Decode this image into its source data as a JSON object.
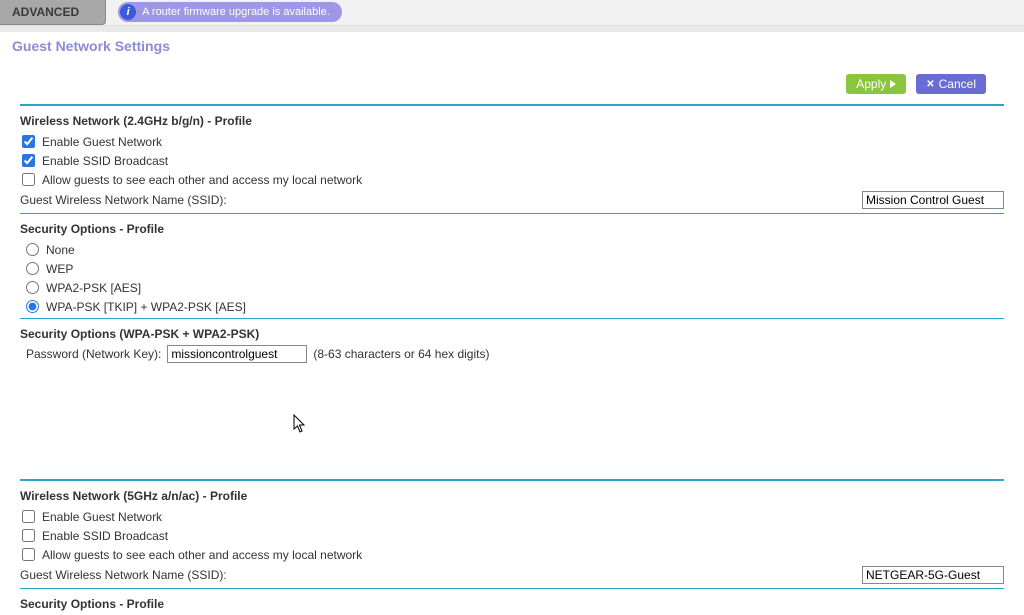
{
  "header": {
    "tab_advanced": "ADVANCED",
    "firmware_notice": "A router firmware upgrade is available."
  },
  "page_title": "Guest Network Settings",
  "buttons": {
    "apply": "Apply",
    "cancel": "Cancel"
  },
  "band24": {
    "title": "Wireless Network (2.4GHz b/g/n) - Profile",
    "enable_guest_label": "Enable Guest Network",
    "enable_guest_checked": true,
    "enable_ssid_label": "Enable SSID Broadcast",
    "enable_ssid_checked": true,
    "allow_guests_label": "Allow guests to see each other and access my local network",
    "allow_guests_checked": false,
    "ssid_label": "Guest Wireless Network Name (SSID):",
    "ssid_value": "Mission Control Guest"
  },
  "security24": {
    "title": "Security Options - Profile",
    "opt_none": "None",
    "opt_wep": "WEP",
    "opt_wpa2": "WPA2-PSK [AES]",
    "opt_mixed": "WPA-PSK [TKIP] + WPA2-PSK [AES]",
    "selected": "mixed",
    "detail_title": "Security Options (WPA-PSK + WPA2-PSK)",
    "password_label": "Password (Network Key):",
    "password_value": "missioncontrolguest",
    "password_hint": "(8-63 characters or 64 hex digits)"
  },
  "band5": {
    "title": "Wireless Network (5GHz a/n/ac) - Profile",
    "enable_guest_label": "Enable Guest Network",
    "enable_guest_checked": false,
    "enable_ssid_label": "Enable SSID Broadcast",
    "enable_ssid_checked": false,
    "allow_guests_label": "Allow guests to see each other and access my local network",
    "allow_guests_checked": false,
    "ssid_label": "Guest Wireless Network Name (SSID):",
    "ssid_value": "NETGEAR-5G-Guest"
  },
  "security5": {
    "title": "Security Options - Profile"
  }
}
